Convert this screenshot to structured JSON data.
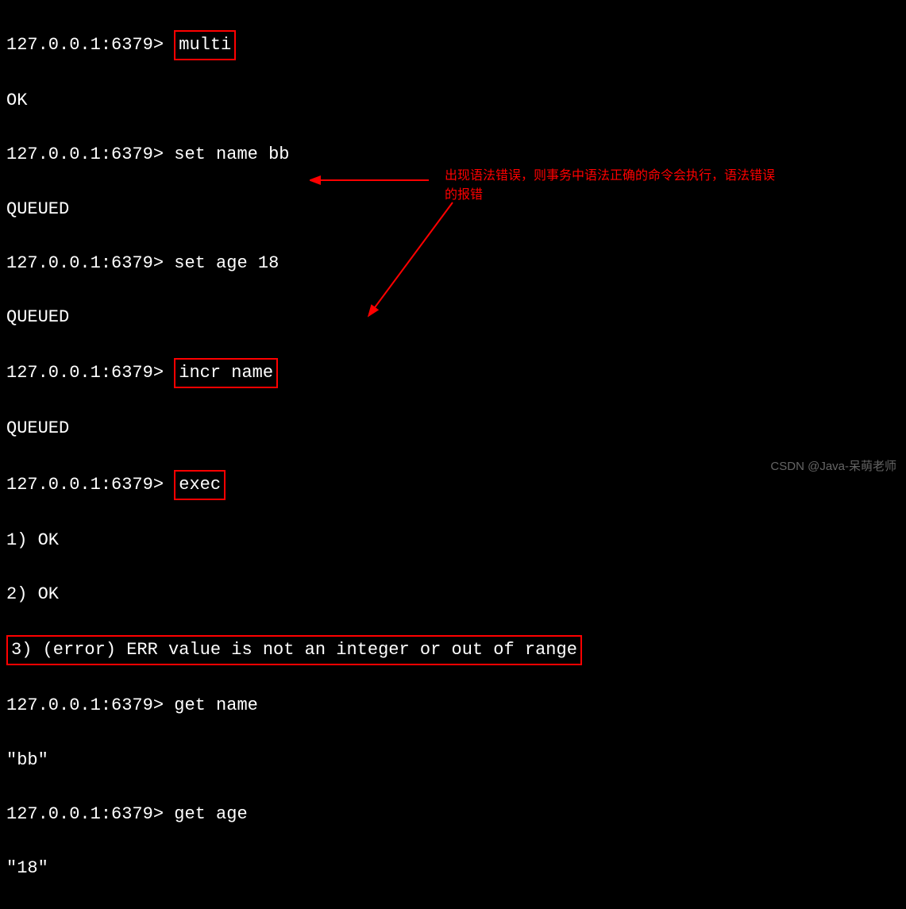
{
  "terminal": {
    "prompt": "127.0.0.1:6379>",
    "lines": [
      {
        "cmd": "multi",
        "boxed": true
      },
      {
        "out": "OK"
      },
      {
        "cmd": "set name bb"
      },
      {
        "out": "QUEUED"
      },
      {
        "cmd": "set age 18"
      },
      {
        "out": "QUEUED"
      },
      {
        "cmd": "incr name",
        "boxed": true
      },
      {
        "out": "QUEUED"
      },
      {
        "cmd": "exec",
        "boxed": true
      },
      {
        "out": "1) OK"
      },
      {
        "out": "2) OK"
      },
      {
        "out": "3) (error) ERR value is not an integer or out of range",
        "boxed_full": true
      },
      {
        "cmd": "get name"
      },
      {
        "out": "\"bb\""
      },
      {
        "cmd": "get age"
      },
      {
        "out": "\"18\""
      }
    ]
  },
  "annotation": {
    "text": "出现语法错误，则事务中语法正确的命令会执行，语法错误的报错"
  },
  "watermark": "CSDN @Java-呆萌老师"
}
